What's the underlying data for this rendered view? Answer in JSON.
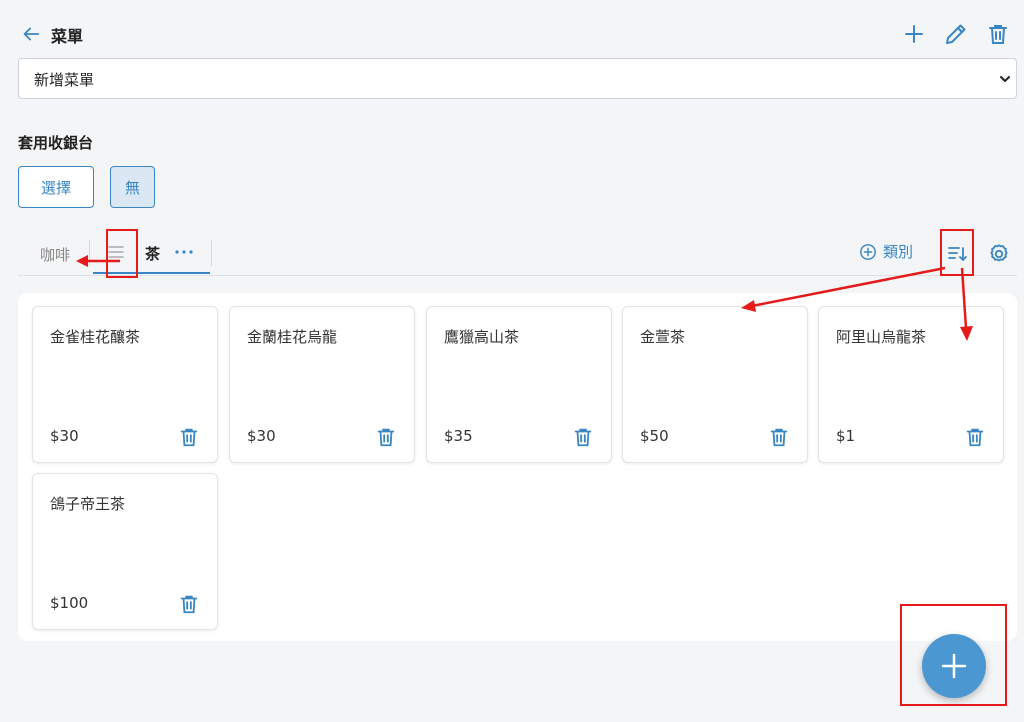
{
  "header": {
    "title": "菜單",
    "icons": [
      "back-arrow-icon",
      "plus-icon",
      "pencil-icon",
      "trash-icon"
    ]
  },
  "menu_select": {
    "value": "新增菜單"
  },
  "register": {
    "label": "套用收銀台",
    "select_label": "選擇",
    "none_label": "無"
  },
  "tabs": {
    "items": [
      {
        "label": "咖啡"
      },
      {
        "label": "茶"
      }
    ],
    "add_category_label": "類別"
  },
  "products": [
    {
      "name": "金雀桂花釀茶",
      "price": "$30"
    },
    {
      "name": "金蘭桂花烏龍",
      "price": "$30"
    },
    {
      "name": "鷹獵高山茶",
      "price": "$35"
    },
    {
      "name": "金萱茶",
      "price": "$50"
    },
    {
      "name": "阿里山烏龍茶",
      "price": "$1"
    },
    {
      "name": "鴿子帝王茶",
      "price": "$100"
    }
  ],
  "colors": {
    "accent": "#3a86c4",
    "fab": "#4a97d1",
    "annotation": "#e51b1b",
    "background": "#f4f5f7"
  }
}
